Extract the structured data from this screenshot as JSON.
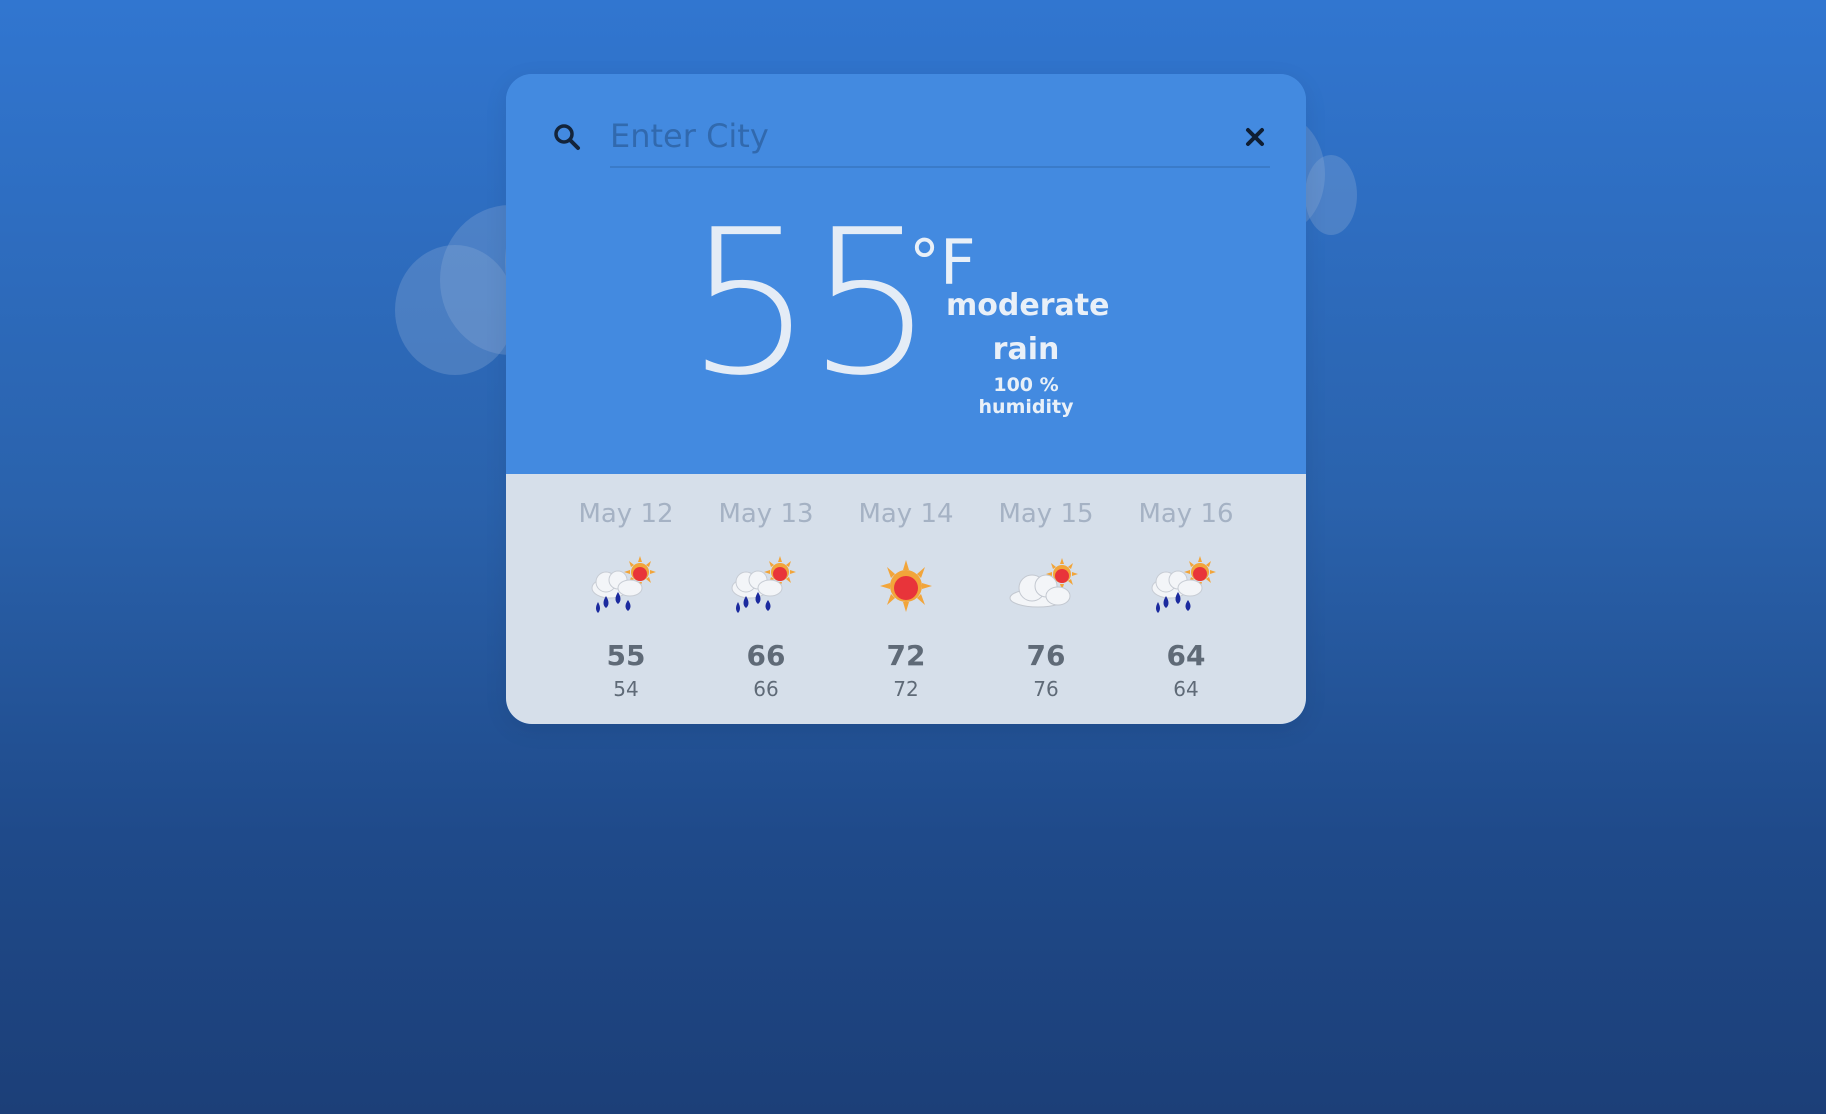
{
  "search": {
    "placeholder": "Enter City",
    "value": ""
  },
  "current": {
    "temperature": "55",
    "unit": "°F",
    "description_line1": "moderate",
    "description_line2": "rain",
    "humidity": "100 % humidity"
  },
  "forecast": [
    {
      "date": "May 12",
      "icon": "rain-sun-icon",
      "high": "55",
      "low": "54"
    },
    {
      "date": "May 13",
      "icon": "rain-sun-icon",
      "high": "66",
      "low": "66"
    },
    {
      "date": "May 14",
      "icon": "sun-icon",
      "high": "72",
      "low": "72"
    },
    {
      "date": "May 15",
      "icon": "cloud-sun-icon",
      "high": "76",
      "low": "76"
    },
    {
      "date": "May 16",
      "icon": "rain-sun-icon",
      "high": "64",
      "low": "64"
    }
  ],
  "colors": {
    "background_top": "#3176d0",
    "background_bottom": "#1c3f78",
    "card_top": "#438ae0",
    "card_bottom": "#d6dfea"
  }
}
